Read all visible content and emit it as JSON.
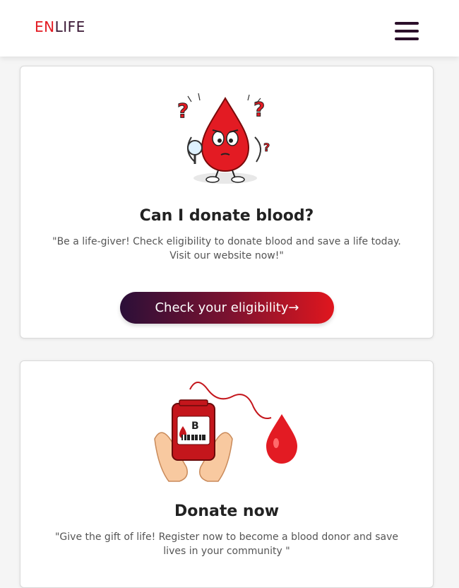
{
  "header": {
    "logo_prefix": "EN",
    "logo_suffix": "LIFE",
    "menu_icon": "hamburger-menu-icon"
  },
  "cards": [
    {
      "illustration_icon": "confused-blood-drop-icon",
      "title": "Can I donate blood?",
      "text_line1": "\"Be a life-giver! Check eligibility to donate blood and save a life today.",
      "text_line2": "Visit our website now!\"",
      "button_label": "Check your eligibility→"
    },
    {
      "illustration_icon": "blood-bag-hands-icon",
      "bag_label": "B",
      "title": "Donate now",
      "text": "\"Give the gift of life! Register now to become a blood donor and save lives in your community \""
    }
  ],
  "colors": {
    "brand_red": "#e31b23",
    "brand_dark": "#3a1734",
    "button_gradient_start": "#2b0f38",
    "button_gradient_end": "#e0161e"
  }
}
